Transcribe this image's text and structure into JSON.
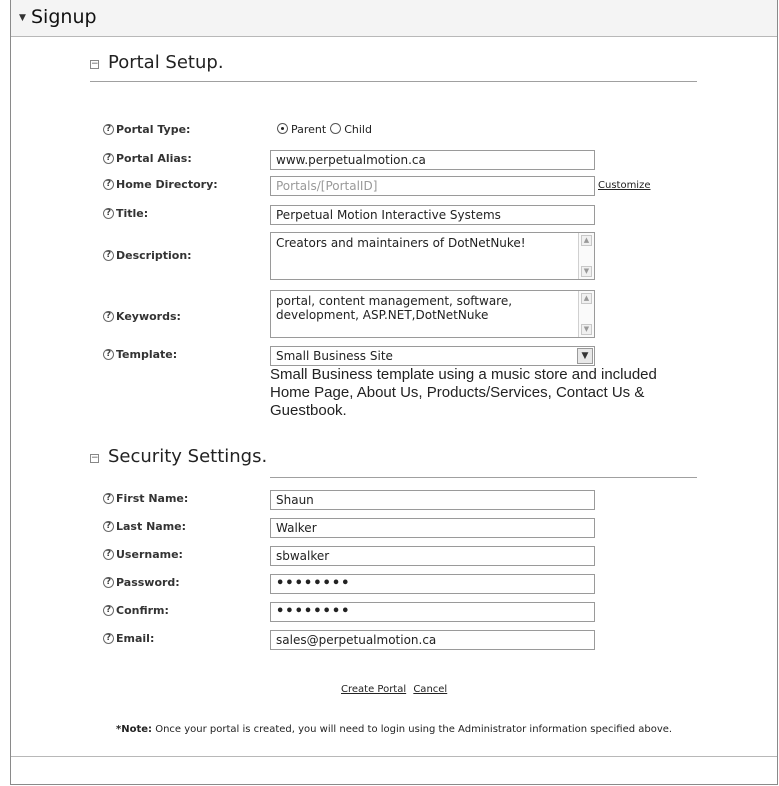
{
  "module": {
    "title": "Signup"
  },
  "portal_setup": {
    "title": "Portal Setup.",
    "portal_type": {
      "label": "Portal Type:",
      "options": [
        "Parent",
        "Child"
      ],
      "selected": "Parent"
    },
    "portal_alias": {
      "label": "Portal Alias:",
      "value": "www.perpetualmotion.ca"
    },
    "home_directory": {
      "label": "Home Directory:",
      "value": "Portals/[PortalID]",
      "action": "Customize"
    },
    "title_field": {
      "label": "Title:",
      "value": "Perpetual Motion Interactive Systems"
    },
    "description": {
      "label": "Description:",
      "value": "Creators and maintainers of DotNetNuke!"
    },
    "keywords": {
      "label": "Keywords:",
      "value": "portal, content management, software, development, ASP.NET,DotNetNuke"
    },
    "template": {
      "label": "Template:",
      "selected": "Small Business Site",
      "description": "Small Business template using a music store and included Home Page, About Us, Products/Services, Contact Us & Guestbook."
    }
  },
  "security_settings": {
    "title": "Security Settings.",
    "first_name": {
      "label": "First Name:",
      "value": "Shaun"
    },
    "last_name": {
      "label": "Last Name:",
      "value": "Walker"
    },
    "username": {
      "label": "Username:",
      "value": "sbwalker"
    },
    "password": {
      "label": "Password:",
      "value": "••••••••"
    },
    "confirm": {
      "label": "Confirm:",
      "value": "••••••••"
    },
    "email": {
      "label": "Email:",
      "value": "sales@perpetualmotion.ca"
    }
  },
  "actions": {
    "create": "Create Portal",
    "cancel": "Cancel"
  },
  "note": {
    "prefix": "*Note:",
    "text": " Once your portal is created, you will need to login using the Administrator information specified above."
  }
}
